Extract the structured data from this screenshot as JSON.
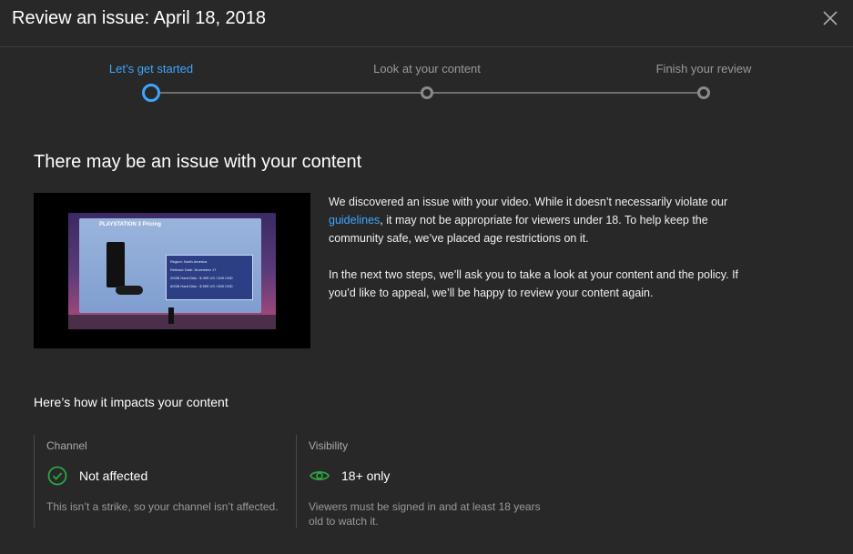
{
  "dialog": {
    "title": "Review an issue: April 18, 2018",
    "close_icon": "close-icon"
  },
  "stepper": {
    "steps": [
      {
        "label": "Let’s get started",
        "state": "active"
      },
      {
        "label": "Look at your content",
        "state": "inactive"
      },
      {
        "label": "Finish your review",
        "state": "inactive"
      }
    ],
    "active_color": "#3ea6ff"
  },
  "main": {
    "heading": "There may be an issue with your content",
    "thumbnail": {
      "screen_title": "PLAYSTATION 3 Pricing",
      "specs": [
        "Region:  North America",
        "Release Date:  November 17",
        "20GB Hard Disk :  $ 499 US / 549 CND",
        "60GB Hard Disk :  $ 599 US / 659 CND"
      ]
    },
    "paragraph1_prefix": "We discovered an issue with your video. While it doesn’t necessarily violate our ",
    "paragraph1_link": "guidelines",
    "paragraph1_suffix": ", it may not be appropriate for viewers under 18. To help keep the community safe, we’ve placed age restrictions on it.",
    "paragraph2": "In the next two steps, we’ll ask you to take a look at your content and the policy. If you’d like to appeal, we’ll be happy to review your content again."
  },
  "impact": {
    "title": "Here’s how it impacts your content",
    "channel": {
      "label": "Channel",
      "icon": "check-circle-icon",
      "status": "Not affected",
      "note": "This isn’t a strike, so your channel isn’t affected.",
      "color": "#2ba640"
    },
    "visibility": {
      "label": "Visibility",
      "icon": "eye-icon",
      "status": "18+ only",
      "note": "Viewers must be signed in and at least 18 years old to watch it.",
      "color": "#2ba640"
    }
  }
}
